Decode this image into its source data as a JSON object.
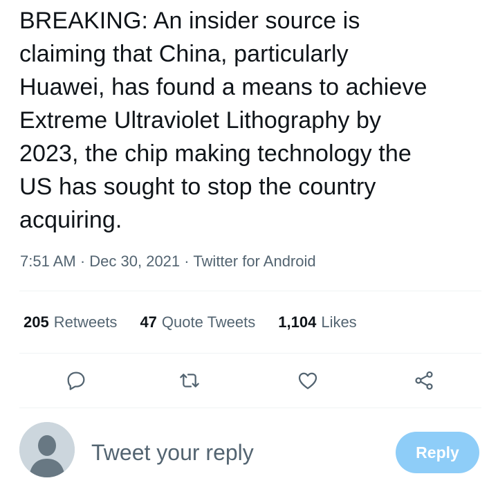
{
  "tweet": {
    "text": "BREAKING: An insider source is\nclaiming that China, particularly\nHuawei, has found a means to achieve\nExtreme Ultraviolet Lithography by\n2023, the chip making technology the\nUS has sought to stop the country\nacquiring.",
    "time": "7:51 AM",
    "date": "Dec 30, 2021",
    "source": "Twitter for Android",
    "separator": " · "
  },
  "stats": {
    "retweets": {
      "count": "205",
      "label": "Retweets"
    },
    "quote_tweets": {
      "count": "47",
      "label": "Quote Tweets"
    },
    "likes": {
      "count": "1,104",
      "label": "Likes"
    }
  },
  "actions": [
    {
      "name": "reply",
      "icon": "reply-icon"
    },
    {
      "name": "retweet",
      "icon": "retweet-icon"
    },
    {
      "name": "like",
      "icon": "heart-icon"
    },
    {
      "name": "share",
      "icon": "share-icon"
    }
  ],
  "reply_box": {
    "placeholder": "Tweet your reply",
    "button_label": "Reply"
  },
  "colors": {
    "text": "#0f1419",
    "secondary": "#536471",
    "divider": "#eff3f4",
    "reply_button": "#8ecdf8",
    "avatar_bg": "#ccd6dd",
    "avatar_fg": "#687883"
  }
}
